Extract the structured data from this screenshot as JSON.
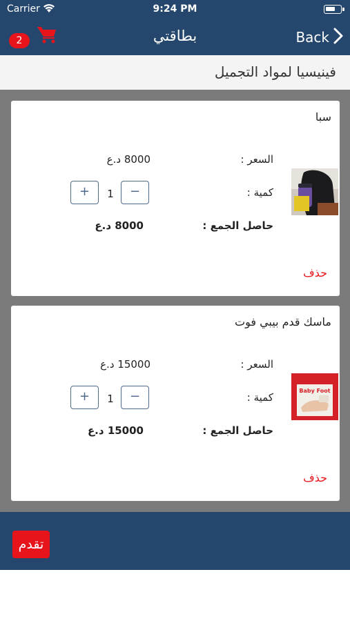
{
  "status_bar": {
    "carrier": "Carrier",
    "time": "9:24 PM"
  },
  "nav": {
    "title": "بطاقتي",
    "back_label": "Back",
    "cart_count": "2"
  },
  "shop": {
    "name": "فينيسيا لمواد التجميل"
  },
  "items": [
    {
      "name": "سبا",
      "price_label": "السعر :",
      "price": "8000 د.ع",
      "qty_label": "كمية :",
      "qty": "1",
      "total_label": "حاصل الجمع :",
      "total": "8000 د.ع",
      "delete_label": "حذف"
    },
    {
      "name": "ماسك قدم بيبي فوت",
      "price_label": "السعر :",
      "price": "15000 د.ع",
      "qty_label": "كمية :",
      "qty": "1",
      "total_label": "حاصل الجمع :",
      "total": "15000 د.ع",
      "delete_label": "حذف"
    }
  ],
  "footer": {
    "proceed_label": "تقدم"
  },
  "colors": {
    "primary": "#25476d",
    "accent": "#e8141b",
    "list_bg": "#7b7b7b",
    "stepper": "#4e6a8c"
  },
  "icons": {
    "cart": "cart-icon",
    "back": "chevron-right-icon",
    "wifi": "wifi-icon",
    "battery": "battery-icon"
  }
}
